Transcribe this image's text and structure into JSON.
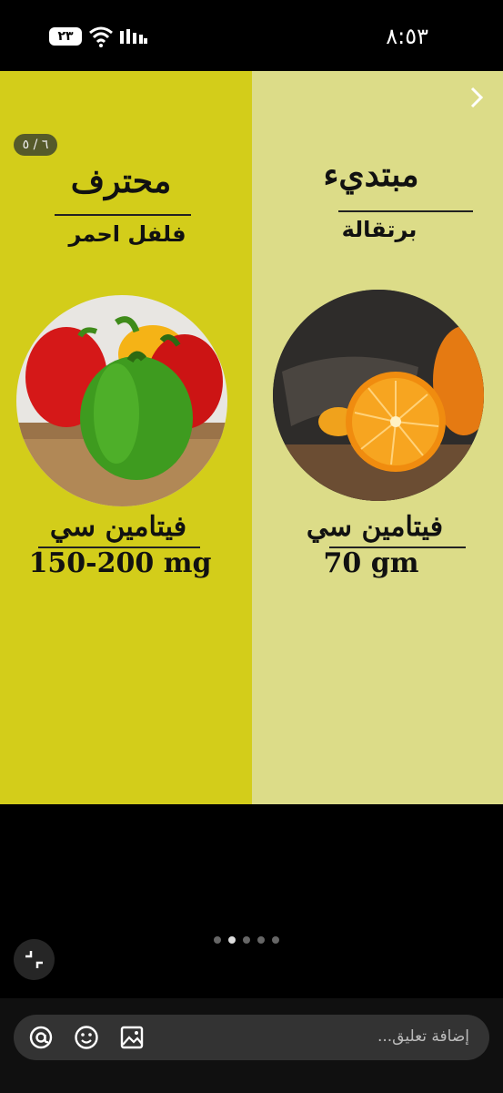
{
  "status_bar": {
    "time": "٨:٥٣",
    "battery": "٢٣"
  },
  "post": {
    "page_counter": "٦ / ٥",
    "right_panel": {
      "title": "مبتديء",
      "subtitle": "برتقالة",
      "vitamin": "فيتامين سي",
      "amount": "70 gm",
      "color": "#dcdc88"
    },
    "left_panel": {
      "title": "محترف",
      "subtitle": "فلفل احمر",
      "vitamin": "فيتامين سي",
      "amount": "150-200 mg",
      "color": "#d3cd1a"
    }
  },
  "carousel": {
    "count": 5,
    "active_index": 1
  },
  "comment": {
    "placeholder": "إضافة تعليق..."
  },
  "icons": {
    "mention": "at-icon",
    "emoji": "emoji-icon",
    "image": "image-icon",
    "collapse": "collapse-icon",
    "next": "chevron-right-icon"
  }
}
